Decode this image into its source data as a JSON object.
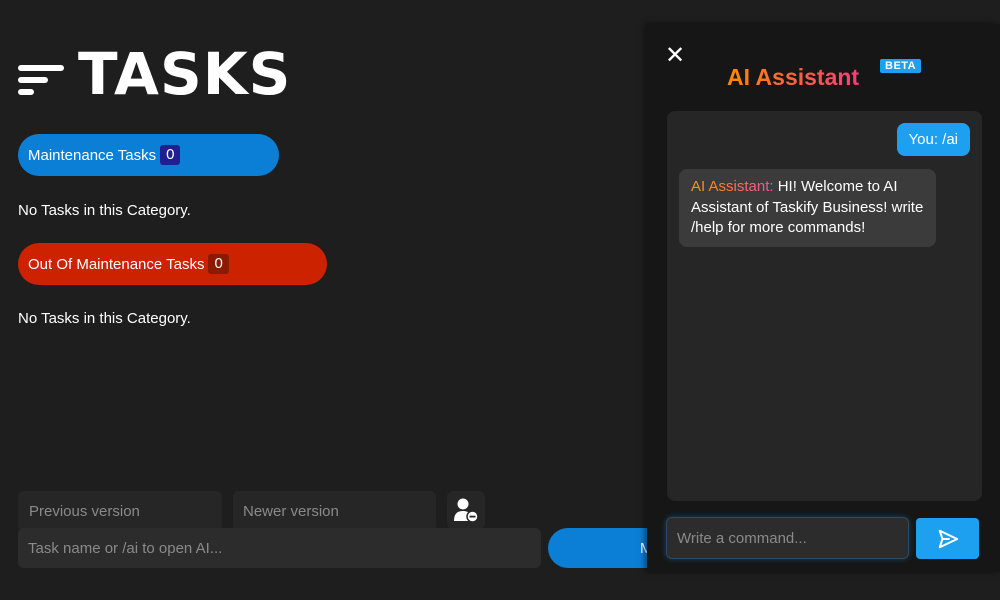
{
  "header": {
    "title": "TASKS",
    "menu_icon": "hamburger-menu-icon"
  },
  "categories": [
    {
      "label": "Maintenance Tasks",
      "count": "0",
      "empty_text": "No Tasks in this Category.",
      "color": "#0b7fd6"
    },
    {
      "label": "Out Of Maintenance Tasks",
      "count": "0",
      "empty_text": "No Tasks in this Category.",
      "color": "#cc2200"
    }
  ],
  "bottom_bar": {
    "previous_version": "Previous version",
    "newer_version": "Newer version",
    "user_icon": "user-settings-icon",
    "task_input_placeholder": "Task name or /ai to open AI...",
    "main_action_label": "M"
  },
  "ai_panel": {
    "close_icon": "close-icon",
    "title": "AI Assistant",
    "badge": "BETA",
    "messages": [
      {
        "from": "user",
        "text": "You: /ai"
      },
      {
        "from": "ai",
        "sender": "AI Assistant:",
        "text": " HI! Welcome to AI Assistant of Taskify Business! write /help for more commands!"
      }
    ],
    "input_placeholder": "Write a command...",
    "send_icon": "send-icon"
  },
  "colors": {
    "background": "#1e1e1e",
    "panel": "#161616",
    "accent_blue": "#1ea0f0",
    "gradient_start": "#ff8a00",
    "gradient_end": "#ff3b7a"
  }
}
